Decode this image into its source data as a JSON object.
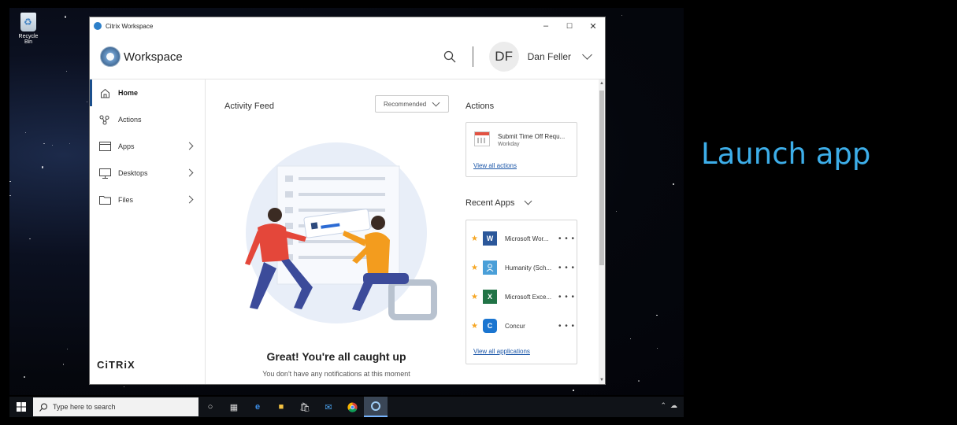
{
  "desktop": {
    "recycle_bin_label": "Recycle Bin",
    "overlay_caption": "Launch app"
  },
  "window": {
    "title": "Citrix Workspace",
    "controls": {
      "minimize": "–",
      "maximize": "☐",
      "close": "✕"
    }
  },
  "header": {
    "brand": "Workspace",
    "user_initials": "DF",
    "user_name": "Dan Feller"
  },
  "sidebar": {
    "items": [
      {
        "label": "Home",
        "icon": "home-icon",
        "active": true,
        "has_chevron": false
      },
      {
        "label": "Actions",
        "icon": "actions-icon",
        "active": false,
        "has_chevron": false
      },
      {
        "label": "Apps",
        "icon": "apps-icon",
        "active": false,
        "has_chevron": true
      },
      {
        "label": "Desktops",
        "icon": "desktop-icon",
        "active": false,
        "has_chevron": true
      },
      {
        "label": "Files",
        "icon": "folder-icon",
        "active": false,
        "has_chevron": true
      }
    ],
    "footer_logo": "CiTRiX"
  },
  "feed": {
    "title": "Activity Feed",
    "filter_value": "Recommended",
    "empty_title": "Great! You're all caught up",
    "empty_subtitle": "You don't have any notifications at this moment"
  },
  "actions": {
    "title": "Actions",
    "item_name": "Submit Time Off Requ...",
    "item_source": "Workday",
    "view_all": "View all actions"
  },
  "recent_apps": {
    "title": "Recent Apps",
    "items": [
      {
        "name": "Microsoft Wor...",
        "icon": "word-icon",
        "glyph": "W",
        "color": "#2b579a"
      },
      {
        "name": "Humanity (Sch...",
        "icon": "humanity-icon",
        "glyph": "",
        "color": "#4a9fd8"
      },
      {
        "name": "Microsoft Exce...",
        "icon": "excel-icon",
        "glyph": "X",
        "color": "#217346"
      },
      {
        "name": "Concur",
        "icon": "concur-icon",
        "glyph": "C",
        "color": "#1b75d0"
      }
    ],
    "more_glyph": "• • •",
    "view_all": "View all applications"
  },
  "taskbar": {
    "search_placeholder": "Type here to search"
  },
  "colors": {
    "accent": "#1b4f8c",
    "link": "#1b56a8",
    "star": "#f6a623",
    "caption": "#3daee9"
  }
}
